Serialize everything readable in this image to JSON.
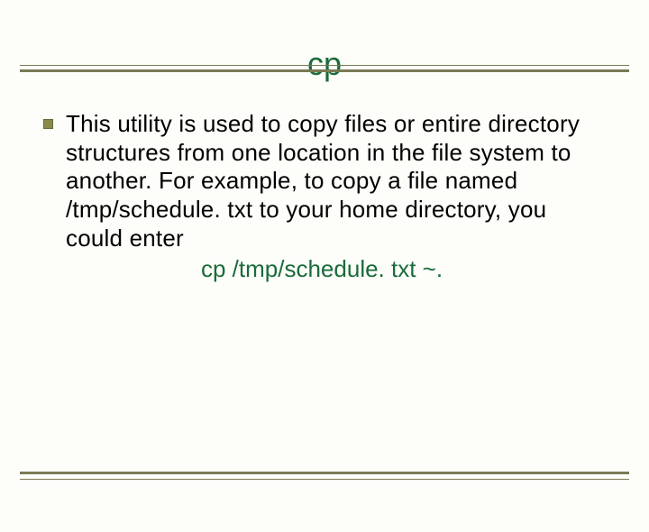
{
  "slide": {
    "title": "cp",
    "body": "This utility is used to copy files or entire directory structures from one location in the file system to another. For example, to copy a file named /tmp/schedule. txt to your home directory, you could enter",
    "example": "cp /tmp/schedule. txt ~."
  }
}
